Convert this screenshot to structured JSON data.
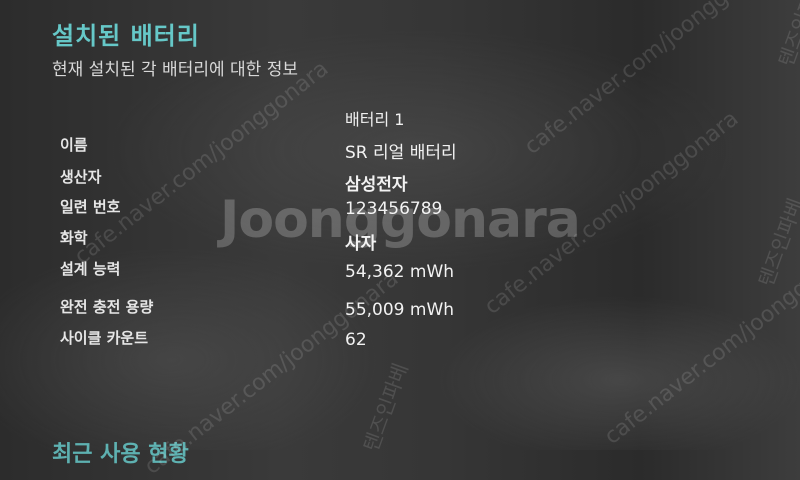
{
  "section": {
    "title": "설치된 배터리",
    "subtitle": "현재 설치된 각 배터리에 대한 정보",
    "column_header": "배터리 1"
  },
  "rows": [
    {
      "label": "이름",
      "value": "SR 리얼 배터리"
    },
    {
      "label": "생산자",
      "value": "삼성전자"
    },
    {
      "label": "일련 번호",
      "value": "123456789"
    },
    {
      "label": "화학",
      "value": "사자"
    },
    {
      "label": "설계 능력",
      "value": "54,362 mWh"
    },
    {
      "label": "완전 충전 용량",
      "value": "55,009 mWh"
    },
    {
      "label": "사이클 카운트",
      "value": "62"
    }
  ],
  "next_section": {
    "title": "최근 사용 현황"
  },
  "watermark": {
    "logo": "Joonggonara",
    "url": "cafe.naver.com/joonggonara",
    "tag": "텐즈인파베"
  },
  "colors": {
    "accent": "#66c8c8",
    "text": "#e8e8e8",
    "background": "#333333"
  }
}
